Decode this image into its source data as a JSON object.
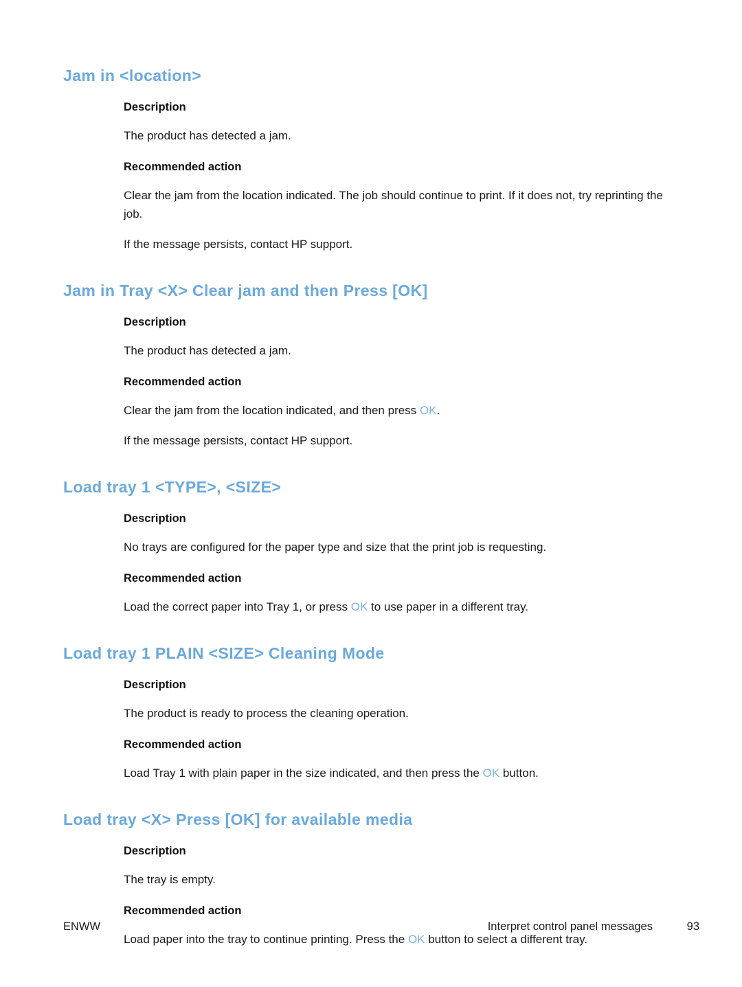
{
  "page": {
    "labels": {
      "description": "Description",
      "recommended_action": "Recommended action"
    },
    "accent_color": "#6aa9dd",
    "inline_ref_color": "#7ab5e0"
  },
  "sections": [
    {
      "heading": "Jam in <location>",
      "description": "The product has detected a jam.",
      "action_paragraphs": [
        {
          "before": "Clear the jam from the location indicated. The job should continue to print. If it does not, try reprinting the job.",
          "ref": "",
          "after": ""
        },
        {
          "before": "If the message persists, contact HP support.",
          "ref": "",
          "after": ""
        }
      ]
    },
    {
      "heading": "Jam in Tray <X> Clear jam and then Press [OK]",
      "description": "The product has detected a jam.",
      "action_paragraphs": [
        {
          "before": "Clear the jam from the location indicated, and then press ",
          "ref": "OK",
          "after": "."
        },
        {
          "before": "If the message persists, contact HP support.",
          "ref": "",
          "after": ""
        }
      ]
    },
    {
      "heading": "Load tray 1 <TYPE>, <SIZE>",
      "description": "No trays are configured for the paper type and size that the print job is requesting.",
      "action_paragraphs": [
        {
          "before": "Load the correct paper into Tray 1, or press ",
          "ref": "OK",
          "after": " to use paper in a different tray."
        }
      ]
    },
    {
      "heading": "Load tray 1 PLAIN <SIZE> Cleaning Mode",
      "description": "The product is ready to process the cleaning operation.",
      "action_paragraphs": [
        {
          "before": "Load Tray 1 with plain paper in the size indicated, and then press the ",
          "ref": "OK",
          "after": " button."
        }
      ]
    },
    {
      "heading": "Load tray <X> Press [OK] for available media",
      "description": "The tray is empty.",
      "action_paragraphs": [
        {
          "before": "Load paper into the tray to continue printing. Press the ",
          "ref": "OK",
          "after": " button to select a different tray."
        }
      ]
    }
  ],
  "footer": {
    "left": "ENWW",
    "title": "Interpret control panel messages",
    "page_number": "93"
  }
}
